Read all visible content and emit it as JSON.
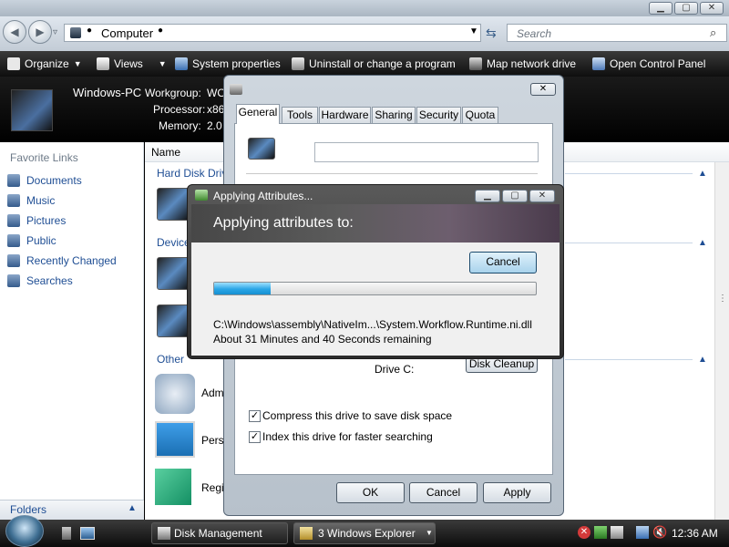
{
  "address": {
    "location": "Computer",
    "search_placeholder": "Search"
  },
  "toolbar": {
    "organize": "Organize",
    "views": "Views",
    "system_properties": "System properties",
    "uninstall": "Uninstall or change a program",
    "map_drive": "Map network drive",
    "control_panel": "Open Control Panel"
  },
  "details": {
    "pc_name": "Windows-PC",
    "workgroup_label": "Workgroup:",
    "workgroup_value": "WO",
    "processor_label": "Processor:",
    "processor_value": "x86",
    "memory_label": "Memory:",
    "memory_value": "2.0"
  },
  "sidebar": {
    "heading": "Favorite Links",
    "items": [
      "Documents",
      "Music",
      "Pictures",
      "Public",
      "Recently Changed",
      "Searches"
    ],
    "folders": "Folders"
  },
  "content": {
    "column_name": "Name",
    "group_hdd": "Hard Disk Drive",
    "group_devices": "Device",
    "group_other": "Other",
    "items": [
      "Adm",
      "Pers",
      "Regi"
    ]
  },
  "properties": {
    "tabs": [
      "General",
      "Tools",
      "Hardware",
      "Sharing",
      "Security",
      "Quota"
    ],
    "drive_label": "Drive C:",
    "disk_cleanup": "Disk Cleanup",
    "compress_label": "Compress this drive to save disk space",
    "compress_checked": true,
    "index_label": "Index this drive for faster searching",
    "index_checked": true,
    "ok": "OK",
    "cancel": "Cancel",
    "apply": "Apply"
  },
  "applying": {
    "title": "Applying Attributes...",
    "heading": "Applying attributes to:",
    "cancel": "Cancel",
    "progress_fraction": 0.175,
    "file_path": "C:\\Windows\\assembly\\NativeIm...\\System.Workflow.Runtime.ni.dll",
    "time_remaining": "About 31 Minutes and 40 Seconds remaining"
  },
  "taskbar": {
    "items": [
      "Disk Management",
      "3 Windows Explorer"
    ],
    "clock": "12:36 AM"
  }
}
